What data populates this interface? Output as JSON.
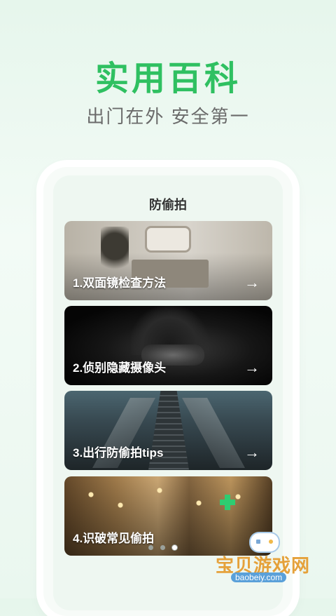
{
  "hero": {
    "title": "实用百科",
    "subtitle": "出门在外 安全第一"
  },
  "screen": {
    "title": "防偷拍",
    "cards": [
      {
        "label": "1.双面镜检查方法",
        "arrow": "→"
      },
      {
        "label": "2.侦别隐藏摄像头",
        "arrow": "→"
      },
      {
        "label": "3.出行防偷拍tips",
        "arrow": "→"
      },
      {
        "label": "4.识破常见偷拍",
        "arrow": "→"
      }
    ],
    "pager": {
      "total": 3,
      "active_index": 2
    }
  },
  "watermark": {
    "text": "宝贝游戏网",
    "url": "baobeiy.com"
  },
  "colors": {
    "accent": "#2fc061",
    "subtitle": "#6b6b6b"
  }
}
